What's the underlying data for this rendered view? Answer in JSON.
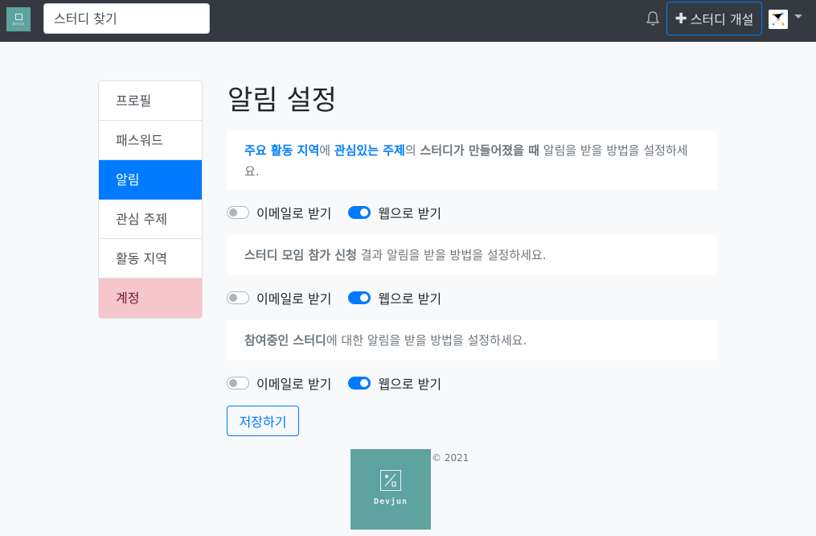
{
  "navbar": {
    "logo_text": "Devjun",
    "search_placeholder": "스터디 찾기",
    "create_button": "스터디 개설"
  },
  "sidebar": {
    "items": [
      {
        "label": "프로필"
      },
      {
        "label": "패스워드"
      },
      {
        "label": "알림"
      },
      {
        "label": "관심 주제"
      },
      {
        "label": "활동 지역"
      },
      {
        "label": "계정"
      }
    ]
  },
  "main": {
    "title": "알림 설정",
    "sections": [
      {
        "desc_parts": [
          "주요 활동 지역",
          "에 ",
          "관심있는 주제",
          "의 ",
          "스터디가 만들어졌을 때",
          " 알림을 받을 방법을 설정하세요."
        ],
        "email_label": "이메일로 받기",
        "email_on": false,
        "web_label": "웹으로 받기",
        "web_on": true
      },
      {
        "desc_parts": [
          "스터디 모임 참가 신청",
          " 결과 알림을 받을 방법을 설정하세요."
        ],
        "email_label": "이메일로 받기",
        "email_on": false,
        "web_label": "웹으로 받기",
        "web_on": true
      },
      {
        "desc_parts": [
          "참여중인 스터디",
          "에 대한 알림을 받을 방법을 설정하세요."
        ],
        "email_label": "이메일로 받기",
        "email_on": false,
        "web_label": "웹으로 받기",
        "web_on": true
      }
    ],
    "save_button": "저장하기"
  },
  "footer": {
    "logo_text": "Devjun",
    "copyright": "© 2021"
  },
  "colors": {
    "primary": "#007bff",
    "navbar": "#343a40",
    "logo_bg": "#5ea3a0",
    "danger_bg": "#f5c6cb"
  }
}
